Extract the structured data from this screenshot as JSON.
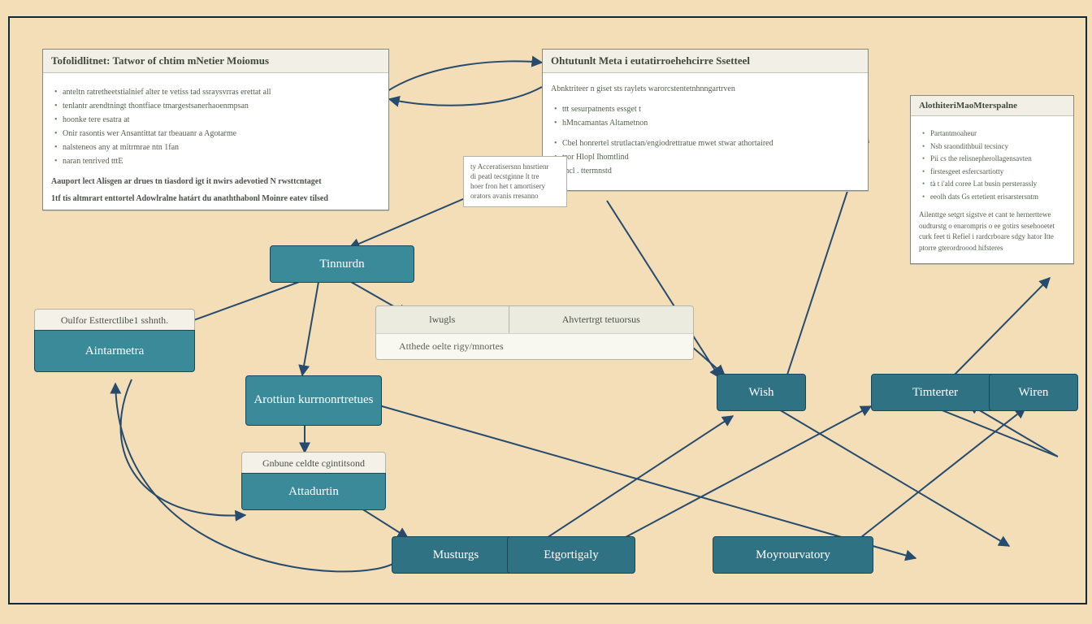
{
  "panels": {
    "left": {
      "title": "Tofolidlitnet: Tatwor of chtim mNetier Moiomus",
      "bullets": [
        "anteltn ratretheetstialnief alter te vetiss tad ssraysvrras erettat all",
        "tenlantr arendtningt thontfiace tmargestsanerhaoenmpsan",
        "hoonke tere esatra at",
        "Onir rasontis wer Ansantittat tar tbeauanr a Agotarme",
        "nalsteneos any at mitrmrae ntn 1fan",
        "naran tenrived tttE"
      ],
      "emph1": "Aauport lect Alisgen ar drues tn tiasdord igt it nwirs adevotied N rwsttcntaget",
      "emph2": "1tf tis altmrart enttortel Adowlralne határt du anaththabonl Moinre eatev tilsed"
    },
    "right": {
      "title": "Ohtutunlt Meta i  eutatirroehehcirre Ssetteel",
      "lead": "Abnktriteer n giset sts raylets warorcstentetnhnngartrven",
      "bullets": [
        "ttt sesurpatnents essget t",
        "hMncamantas Altametnon"
      ],
      "items": [
        "Cbel honrertel strutlactan/engiodrettratue mwet stwar athortaired",
        "tror Hlopl Ihomtlind",
        "fncl . ttermnstd"
      ]
    },
    "side": {
      "title": "AlothiteriMaoMterspalne",
      "bullets": [
        "Partantmoaheur",
        "Nsb sraondithbuil tecsincy",
        "Pii cs the relisnepherollagensavten",
        "firstesgeet esfercsartiotty",
        "tà t i'ald coree Lat busin persterassly",
        "eeolh dats Gs ertetient erisarstersntm"
      ],
      "para": "Ailenttge setgrt sigstve et cant te hernerttewe oudturstg o enarompris o ee gotirs sesehooetet curk feet ti Refiel i rardcrboare sdgy hator Itte ptorre gterordroood hifsteres"
    },
    "note": {
      "l1": "ty Acceratisersnn hnsrtienr",
      "l2": "di peatl tecstginne lt tre",
      "l3": "hoer fron het t amortisery",
      "l4": "orators avanis rresanno"
    }
  },
  "nodes": {
    "tinnurdn": "Tinnurdn",
    "aintarmetra": "Aintarmetra",
    "aintarmetra_label": "Oulfor Estterctlibe1 sshnth.",
    "arottiun": "Arottiun kurrnonrtretues",
    "attadurtin": "Attadurtin",
    "attadurtin_label": "Gnbune celdte cgintitsond",
    "musturgs": "Musturgs",
    "etgortigaly": "Etgortigaly",
    "moyrourvatory": "Moyrourvatory",
    "wish": "Wish",
    "timterter": "Timterter",
    "wiren": "Wiren"
  },
  "tabs": {
    "tab1": "lwugls",
    "tab2": "Ahvtertrgt tetuorsus",
    "sub": "Atthede oelte rigy/mnortes"
  }
}
